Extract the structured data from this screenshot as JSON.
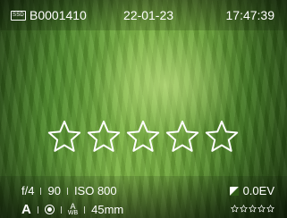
{
  "topbar": {
    "storage_badge": "SSD",
    "file_name": "B0001410",
    "date": "22-01-23",
    "time": "17:47:39"
  },
  "rating": {
    "value": 0,
    "max": 5
  },
  "exposure": {
    "aperture": "f/4",
    "shutter": "90",
    "iso": "ISO 800",
    "ev": "0.0EV"
  },
  "shooting": {
    "mode": "A",
    "metering_icon": "metering-icon",
    "wb_mode": "A",
    "wb_sub": "WB",
    "focal_length": "45mm"
  },
  "icons": {
    "storage": "ssd-icon",
    "ev": "exposure-compensation-icon",
    "star": "star-outline-icon"
  },
  "colors": {
    "text": "#ffffff",
    "background_green": "#6ea63a"
  }
}
